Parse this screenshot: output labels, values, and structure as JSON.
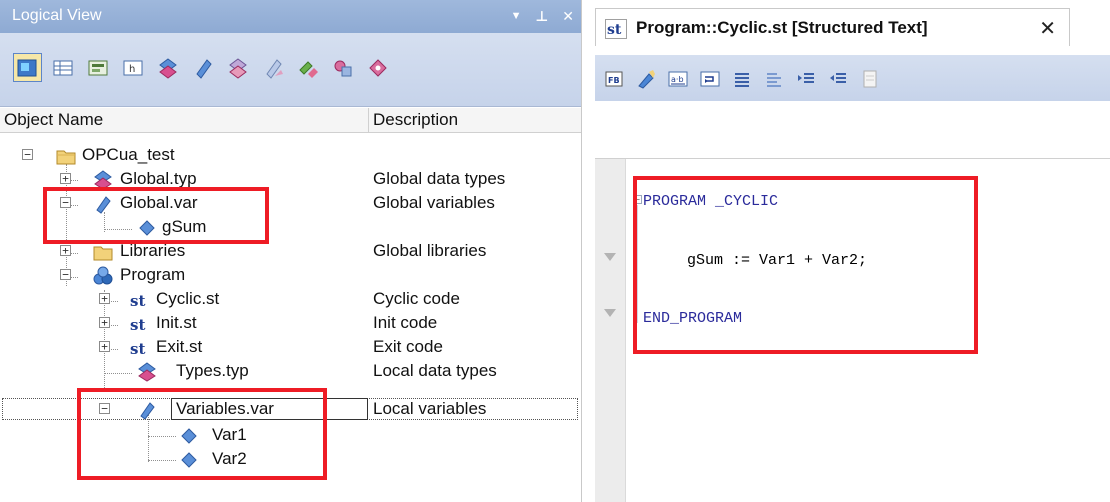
{
  "logical_view": {
    "title": "Logical View",
    "controls": {
      "dropdown": "▼",
      "pin": "⊥",
      "close": "✕"
    },
    "toolbar_icons": [
      "logical-view-icon",
      "table-icon",
      "form-icon",
      "help-icon",
      "datatype-icon",
      "variable-icon",
      "datatype-local-icon",
      "variable-local-icon",
      "connect-icon",
      "group-icon",
      "tag-icon"
    ],
    "columns": {
      "name": "Object Name",
      "description": "Description"
    },
    "tree": [
      {
        "label": "OPCua_test",
        "desc": "",
        "icon": "folder-icon"
      },
      {
        "label": "Global.typ",
        "desc": "Global data types",
        "icon": "datatype-icon"
      },
      {
        "label": "Global.var",
        "desc": "Global variables",
        "icon": "variable-icon"
      },
      {
        "label": "gSum",
        "desc": "",
        "icon": "variable-icon"
      },
      {
        "label": "Libraries",
        "desc": "Global libraries",
        "icon": "folder-icon"
      },
      {
        "label": "Program",
        "desc": "",
        "icon": "program-icon"
      },
      {
        "label": "Cyclic.st",
        "desc": "Cyclic code",
        "icon": "st-file-icon"
      },
      {
        "label": "Init.st",
        "desc": "Init code",
        "icon": "st-file-icon"
      },
      {
        "label": "Exit.st",
        "desc": "Exit code",
        "icon": "st-file-icon"
      },
      {
        "label": "Types.typ",
        "desc": "Local data types",
        "icon": "datatype-icon"
      },
      {
        "label": "Variables.var",
        "desc": "Local variables",
        "icon": "variable-icon"
      },
      {
        "label": "Var1",
        "desc": "",
        "icon": "variable-icon"
      },
      {
        "label": "Var2",
        "desc": "",
        "icon": "variable-icon"
      }
    ]
  },
  "editor": {
    "tab_title": "Program::Cyclic.st [Structured Text]",
    "tab_icon_text": "st",
    "tab_close": "✕",
    "toolbar_icons": [
      "function-block-icon",
      "pencil-icon",
      "replace-icon",
      "insert-icon",
      "align-icon",
      "comment-icon",
      "indent-icon",
      "outdent-icon",
      "page-icon"
    ],
    "code": {
      "line1_kw": "PROGRAM",
      "line1_name": "_CYCLIC",
      "line2": "gSum := Var1 + Var2;",
      "line3_kw": "END_PROGRAM"
    }
  },
  "colors": {
    "highlight_box": "#ee1c25",
    "title_bar": "#9fb8dc",
    "keyword": "#2b2b9b"
  }
}
